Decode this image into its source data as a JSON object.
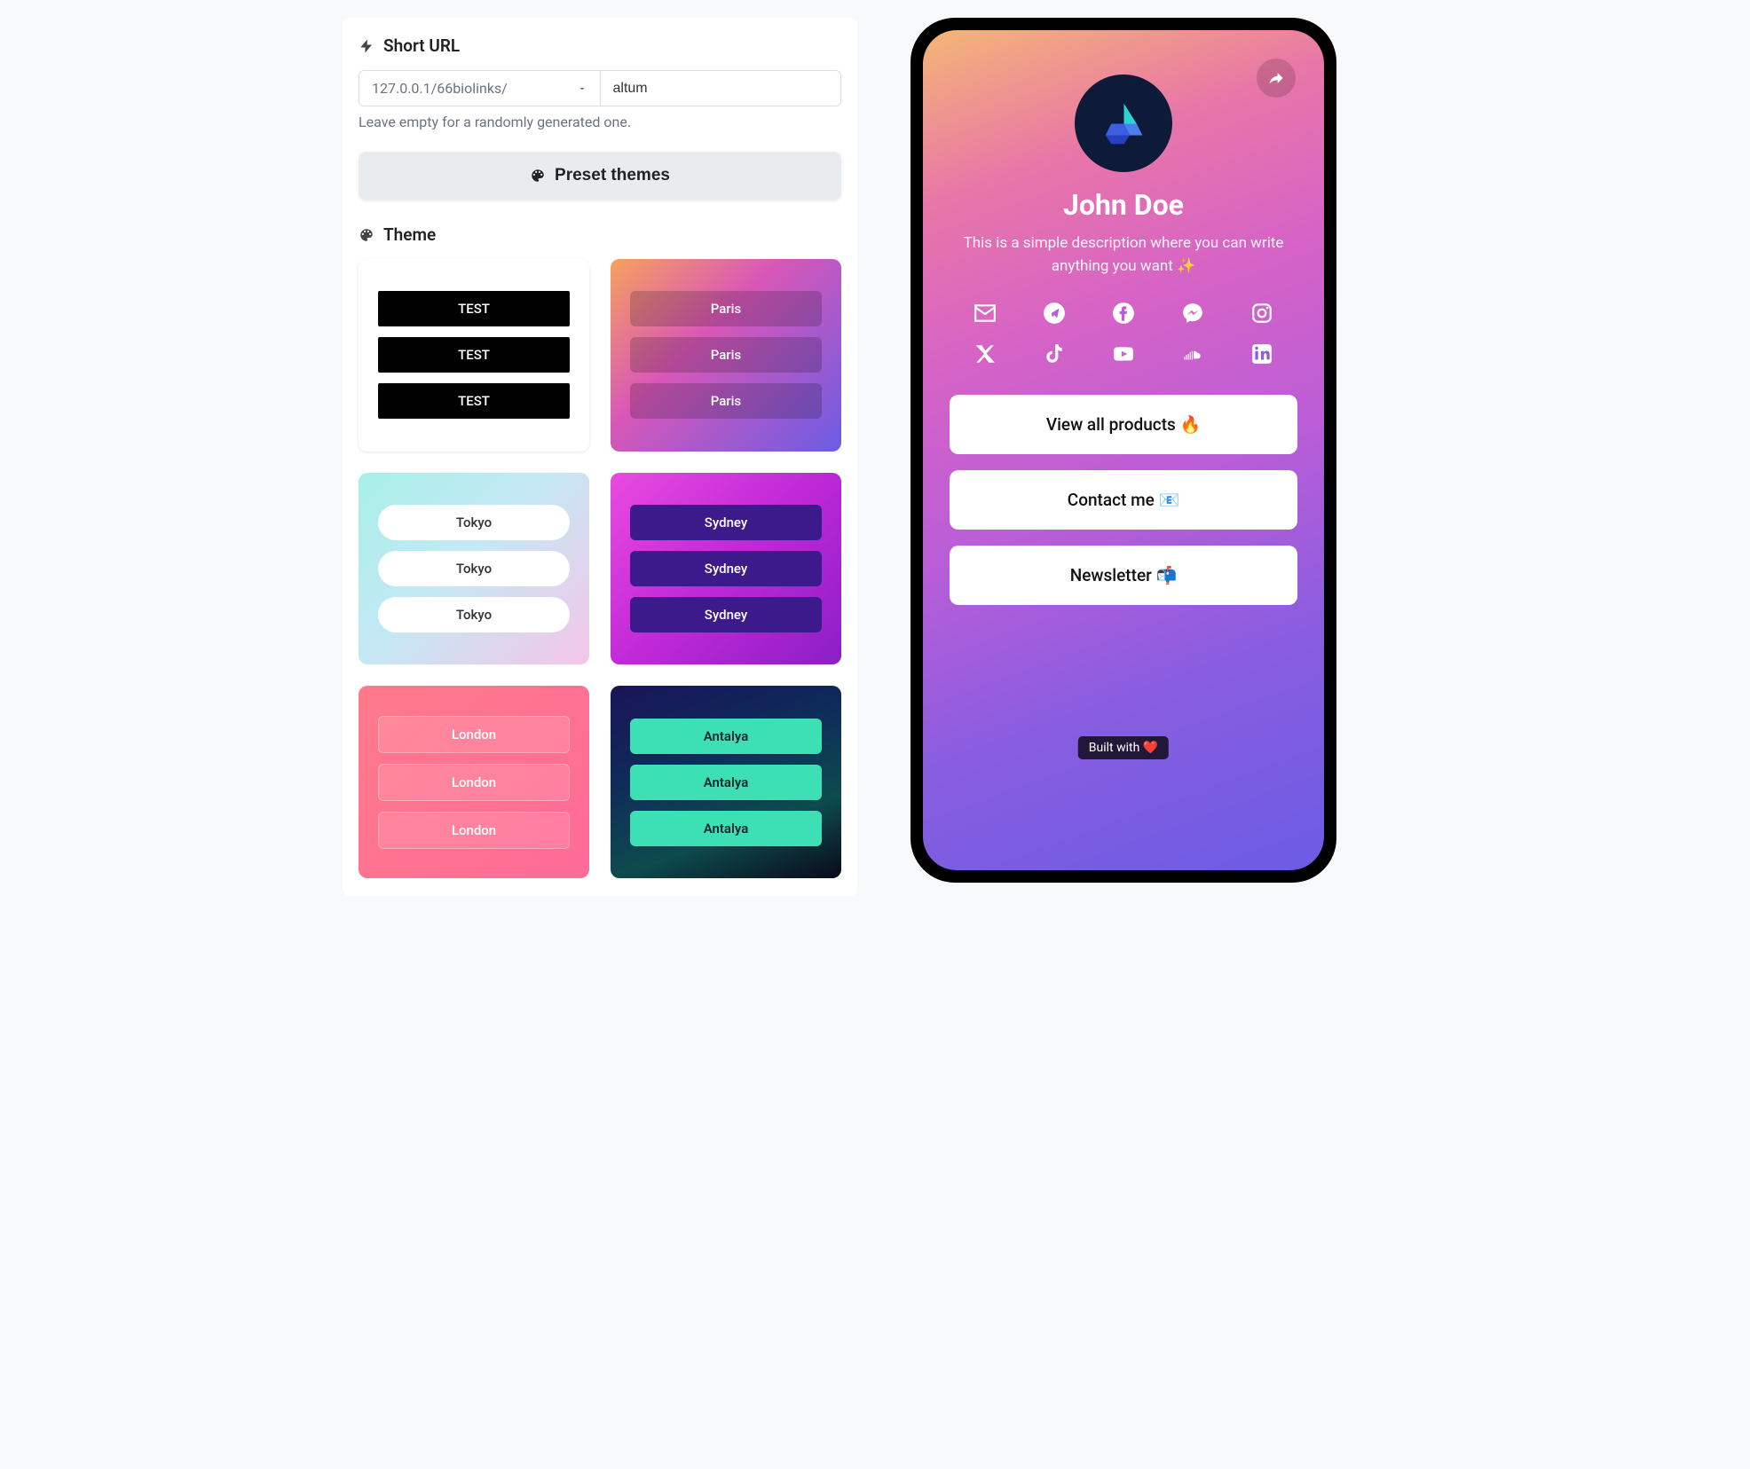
{
  "shortUrl": {
    "label": "Short URL",
    "prefix": "127.0.0.1/66biolinks/",
    "value": "altum",
    "hint": "Leave empty for a randomly generated one."
  },
  "presetThemes": {
    "label": "Preset themes"
  },
  "theme": {
    "label": "Theme"
  },
  "themes": [
    {
      "id": "t1",
      "rows": [
        "TEST",
        "TEST",
        "TEST"
      ]
    },
    {
      "id": "t2",
      "rows": [
        "Paris",
        "Paris",
        "Paris"
      ]
    },
    {
      "id": "t3",
      "rows": [
        "Tokyo",
        "Tokyo",
        "Tokyo"
      ]
    },
    {
      "id": "t4",
      "rows": [
        "Sydney",
        "Sydney",
        "Sydney"
      ]
    },
    {
      "id": "t5",
      "rows": [
        "London",
        "London",
        "London"
      ]
    },
    {
      "id": "t6",
      "rows": [
        "Antalya",
        "Antalya",
        "Antalya"
      ]
    }
  ],
  "preview": {
    "name": "John Doe",
    "description": "This is a simple description where you can write anything you want ✨",
    "socials": [
      "email",
      "telegram",
      "facebook",
      "messenger",
      "instagram",
      "x",
      "tiktok",
      "youtube",
      "soundcloud",
      "linkedin"
    ],
    "links": [
      "View all products 🔥",
      "Contact me 📧",
      "Newsletter 📬"
    ],
    "builtWith": "Built with ❤️"
  }
}
